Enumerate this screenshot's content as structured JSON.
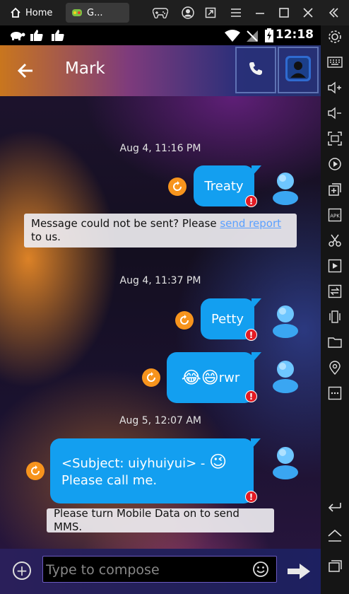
{
  "topbar": {
    "tabs": [
      {
        "label": "Home"
      },
      {
        "label": "G..."
      }
    ]
  },
  "status": {
    "time": "12:18"
  },
  "header": {
    "contact_name": "Mark"
  },
  "messages": {
    "dates": [
      "Aug 4, 11:16 PM",
      "Aug 4, 11:37 PM",
      "Aug 5, 12:07 AM"
    ],
    "items": [
      {
        "text": "Treaty"
      },
      {
        "text": "Petty"
      },
      {
        "text": "rwr",
        "emoji": [
          "😂",
          "😄"
        ]
      },
      {
        "line1": "<Subject: uiyhuiyui> - ",
        "line2": "Please call me.",
        "emoji": "😉"
      }
    ],
    "error_badge": "!"
  },
  "notices": {
    "send_failed_prefix": "Message could not be sent? Please ",
    "send_failed_link": "send report",
    "send_failed_suffix": " to us.",
    "mobile_data": "Please turn Mobile Data on to send MMS."
  },
  "compose": {
    "placeholder": "Type to compose",
    "add_symbol": "+"
  },
  "colors": {
    "bubble": "#139ff0",
    "error": "#e31b23",
    "retry": "#f7941d",
    "link": "#5aa0ff"
  },
  "icons": {
    "sidebar": [
      "settings-icon",
      "keyboard-icon",
      "volume-up-icon",
      "volume-down-icon",
      "screenshot-icon",
      "rotate-icon",
      "add-window-icon",
      "apk-icon",
      "scissors-icon",
      "video-icon",
      "sync-icon",
      "shake-icon",
      "folder-icon",
      "location-icon",
      "more-icon",
      "back-icon",
      "home-icon",
      "recent-apps-icon"
    ]
  }
}
